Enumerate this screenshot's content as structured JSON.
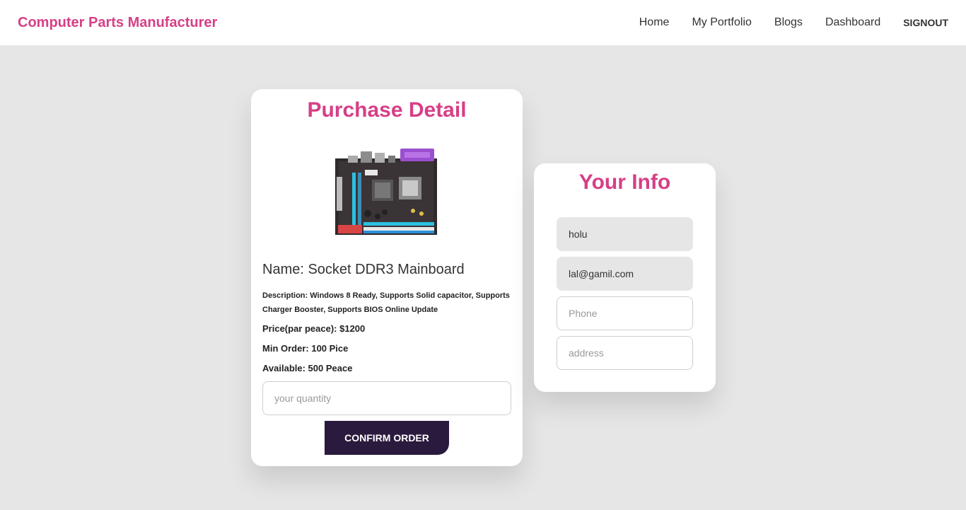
{
  "navbar": {
    "brand": "Computer Parts Manufacturer",
    "links": [
      "Home",
      "My Portfolio",
      "Blogs",
      "Dashboard"
    ],
    "signout": "SIGNOUT"
  },
  "purchase": {
    "title": "Purchase Detail",
    "image_label": "motherboard-product-image",
    "name": "Name: Socket DDR3 Mainboard",
    "description": "Description: Windows 8 Ready, Supports Solid capacitor, Supports Charger Booster, Supports BIOS Online Update",
    "price": "Price(par peace): $1200",
    "min_order": "Min Order: 100 Pice",
    "available": "Available: 500 Peace",
    "quantity_placeholder": "your quantity",
    "confirm_label": "CONFIRM ORDER"
  },
  "info": {
    "title": "Your Info",
    "name_value": "holu",
    "email_value": "lal@gamil.com",
    "phone_placeholder": "Phone",
    "address_placeholder": "address"
  },
  "colors": {
    "accent": "#d63f86",
    "button": "#2a1a3d",
    "page_bg": "#e6e6e6"
  }
}
